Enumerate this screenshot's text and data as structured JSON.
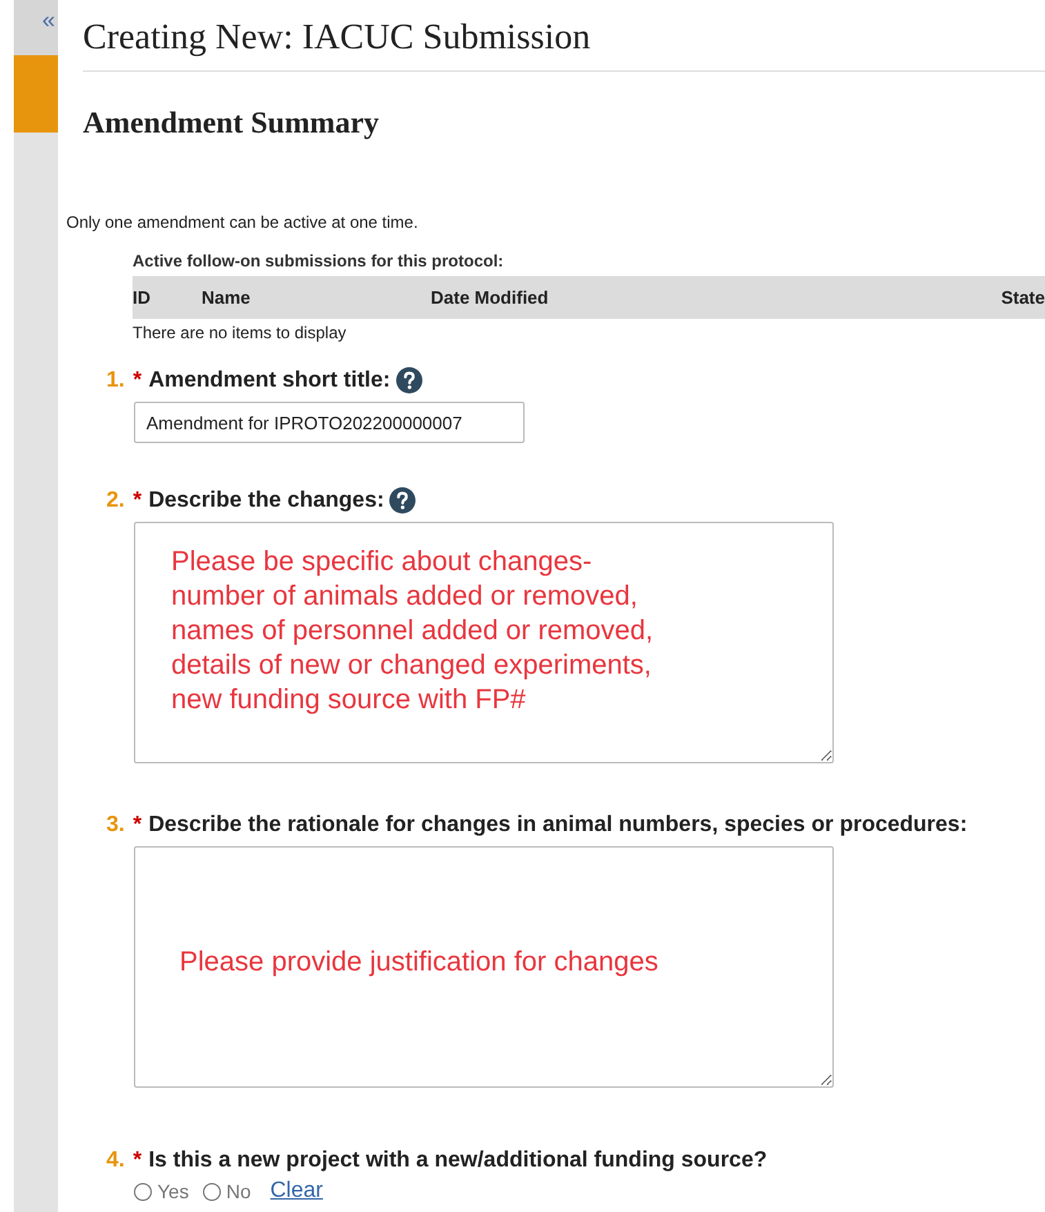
{
  "sidebar": {
    "collapse_icon": "«"
  },
  "header": {
    "title": "Creating New: IACUC Submission",
    "subtitle": "Amendment Summary"
  },
  "notice": "Only one amendment can be active at one time.",
  "followons": {
    "caption": "Active follow-on submissions for this protocol:",
    "columns": [
      "ID",
      "Name",
      "Date Modified",
      "State"
    ],
    "empty_text": "There are no items to display"
  },
  "questions": [
    {
      "number": "1.",
      "required_mark": "*",
      "label": "Amendment short title:",
      "help": true,
      "kind": "text",
      "value": "Amendment for IPROTO202200000007"
    },
    {
      "number": "2.",
      "required_mark": "*",
      "label": "Describe the changes:",
      "help": true,
      "kind": "textarea",
      "value": "Please be specific about changes-\nnumber of animals added or removed,\nnames of personnel added or removed,\ndetails of new or changed experiments,\nnew funding source with FP#"
    },
    {
      "number": "3.",
      "required_mark": "*",
      "label": "Describe the rationale for changes in animal numbers, species or procedures:",
      "help": false,
      "kind": "textarea",
      "value": "Please provide justification for changes"
    },
    {
      "number": "4.",
      "required_mark": "*",
      "label": "Is this a new project with a new/additional funding source?",
      "help": false,
      "kind": "radio",
      "options": [
        {
          "label": "Yes",
          "selected": false
        },
        {
          "label": "No",
          "selected": false
        }
      ],
      "clear": "Clear"
    }
  ]
}
